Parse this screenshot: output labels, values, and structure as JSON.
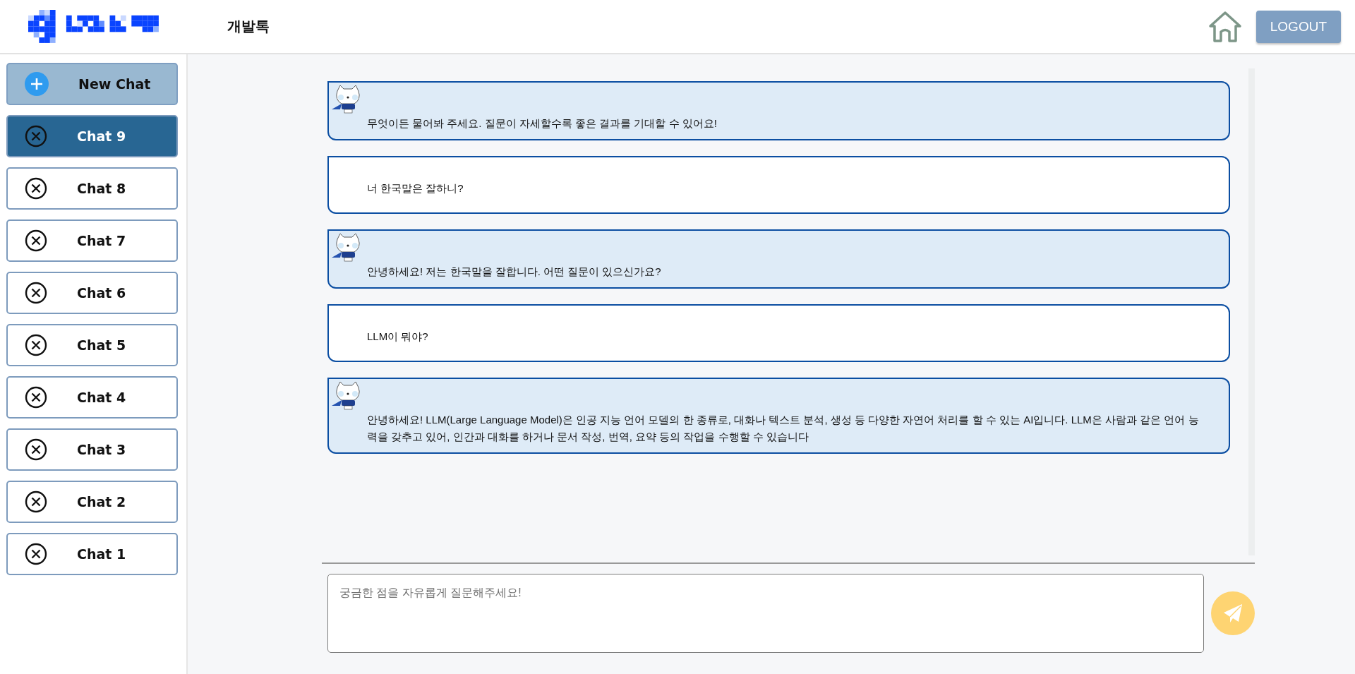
{
  "header": {
    "title": "개발톡",
    "logout": "LOGOUT"
  },
  "sidebar": {
    "items": [
      {
        "kind": "new",
        "label": "New Chat",
        "selected": false
      },
      {
        "kind": "chat",
        "label": "Chat 9",
        "selected": true
      },
      {
        "kind": "chat",
        "label": "Chat 8",
        "selected": false
      },
      {
        "kind": "chat",
        "label": "Chat 7",
        "selected": false
      },
      {
        "kind": "chat",
        "label": "Chat 6",
        "selected": false
      },
      {
        "kind": "chat",
        "label": "Chat 5",
        "selected": false
      },
      {
        "kind": "chat",
        "label": "Chat 4",
        "selected": false
      },
      {
        "kind": "chat",
        "label": "Chat 3",
        "selected": false
      },
      {
        "kind": "chat",
        "label": "Chat 2",
        "selected": false
      },
      {
        "kind": "chat",
        "label": "Chat 1",
        "selected": false
      }
    ]
  },
  "messages": [
    {
      "kind": "bot",
      "text": "무엇이든 물어봐 주세요. 질문이 자세할수록 좋은 결과를 기대할 수 있어요!"
    },
    {
      "kind": "user",
      "text": "너 한국말은 잘하니?"
    },
    {
      "kind": "bot",
      "text": "안녕하세요! 저는 한국말을 잘합니다. 어떤 질문이 있으신가요?"
    },
    {
      "kind": "user",
      "text": "LLM이 뭐야?"
    },
    {
      "kind": "bot",
      "text": "안녕하세요! LLM(Large Language Model)은 인공 지능 언어 모델의 한 종류로, 대화나 텍스트 분석, 생성 등 다양한 자연어 처리를 할 수 있는 AI입니다. LLM은 사람과 같은 언어 능력을 갖추고 있어, 인간과 대화를 하거나 문서 작성, 번역, 요약 등의 작업을 수행할 수 있습니다"
    }
  ],
  "composer": {
    "placeholder": "궁금한 점을 자유롭게 질문해주세요!"
  }
}
